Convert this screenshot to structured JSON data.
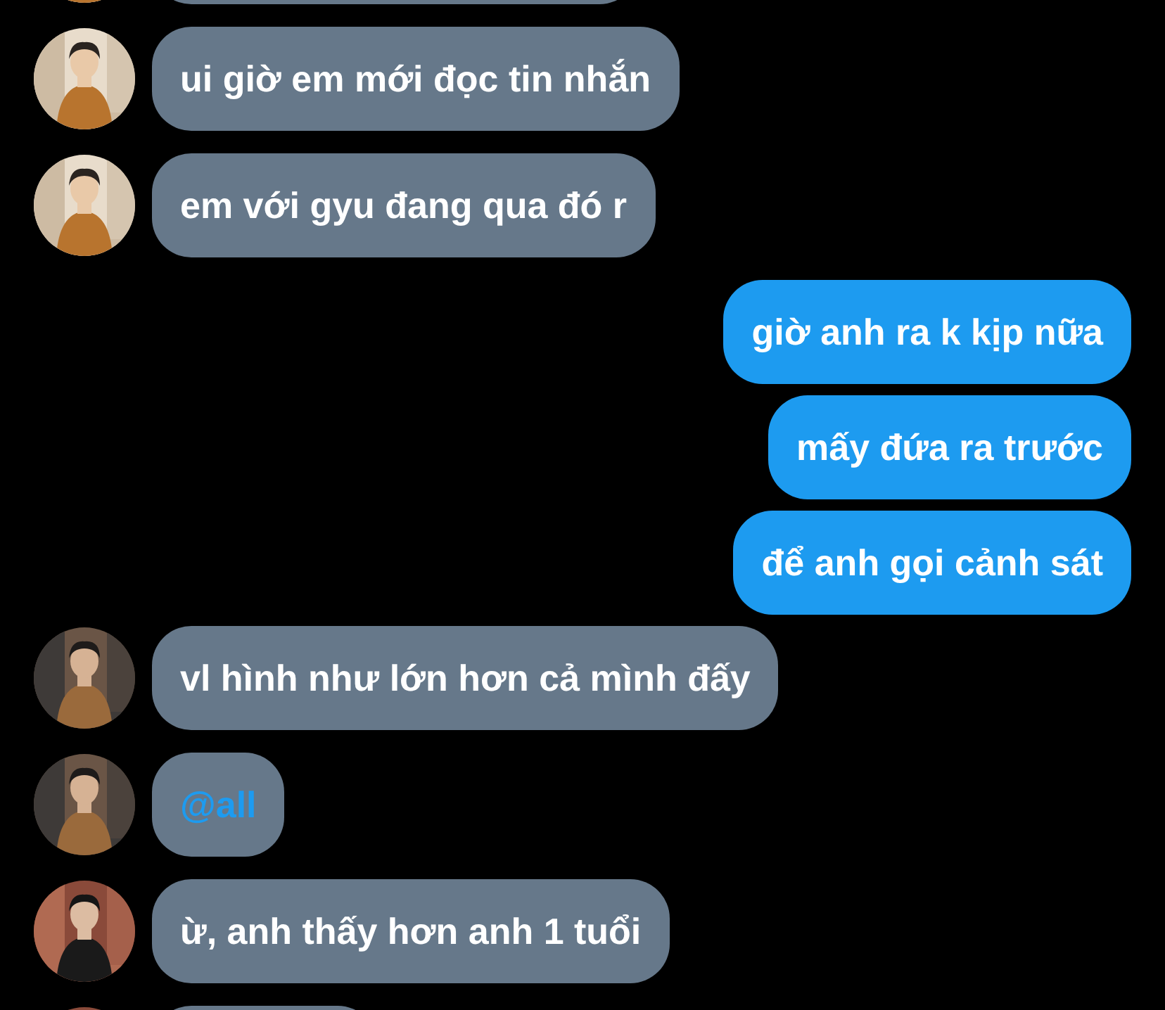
{
  "messages": [
    {
      "outgoing": false,
      "kind": "clipped"
    },
    {
      "outgoing": false,
      "kind": "text",
      "text": "ui giờ em mới đọc tin nhắn",
      "mention": false
    },
    {
      "outgoing": false,
      "kind": "text",
      "text": "em với gyu đang qua đó r",
      "mention": false
    },
    {
      "outgoing": true,
      "kind": "text",
      "text": "giờ anh ra k kịp nữa",
      "mention": false
    },
    {
      "outgoing": true,
      "kind": "text",
      "text": "mấy đứa ra trước",
      "mention": false
    },
    {
      "outgoing": true,
      "kind": "text",
      "text": "để anh gọi cảnh sát",
      "mention": false
    },
    {
      "outgoing": false,
      "kind": "text",
      "text": "vl hình như lớn hơn cả mình đấy",
      "mention": false
    },
    {
      "outgoing": false,
      "kind": "text",
      "text": "@all",
      "mention": true
    },
    {
      "outgoing": false,
      "kind": "text",
      "text": "ừ, anh thấy hơn anh 1 tuổi",
      "mention": false
    },
    {
      "outgoing": false,
      "kind": "clipped"
    }
  ]
}
